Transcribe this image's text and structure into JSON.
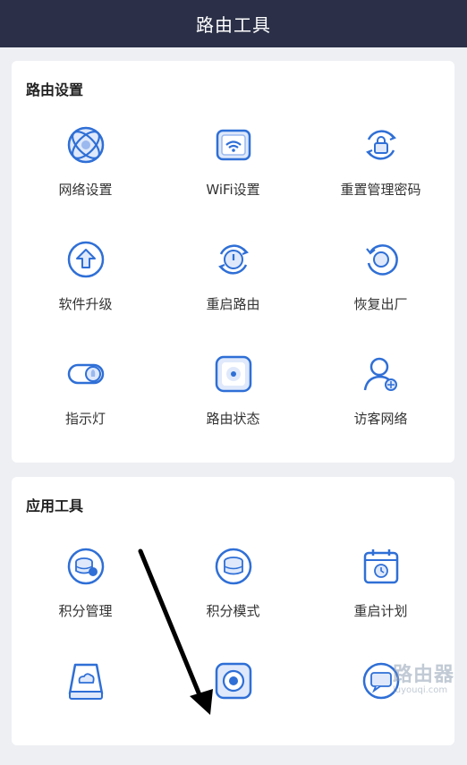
{
  "header": {
    "title": "路由工具"
  },
  "router_settings": {
    "title": "路由设置",
    "items": [
      {
        "label": "网络设置",
        "icon": "globe-icon"
      },
      {
        "label": "WiFi设置",
        "icon": "wifi-icon"
      },
      {
        "label": "重置管理密码",
        "icon": "lock-reset-icon"
      },
      {
        "label": "软件升级",
        "icon": "upgrade-arrow-icon"
      },
      {
        "label": "重启路由",
        "icon": "power-restart-icon"
      },
      {
        "label": "恢复出厂",
        "icon": "factory-reset-icon"
      },
      {
        "label": "指示灯",
        "icon": "indicator-toggle-icon"
      },
      {
        "label": "路由状态",
        "icon": "router-status-icon"
      },
      {
        "label": "访客网络",
        "icon": "guest-user-icon"
      }
    ]
  },
  "app_tools": {
    "title": "应用工具",
    "items": [
      {
        "label": "积分管理",
        "icon": "points-manage-icon"
      },
      {
        "label": "积分模式",
        "icon": "points-mode-icon"
      },
      {
        "label": "重启计划",
        "icon": "restart-schedule-icon"
      },
      {
        "label": "",
        "icon": "cloud-storage-icon"
      },
      {
        "label": "",
        "icon": "target-device-icon"
      },
      {
        "label": "",
        "icon": "message-icon"
      }
    ]
  },
  "watermark": {
    "main": "路由器",
    "sub": "luyouqi.com"
  },
  "colors": {
    "header_bg": "#2b3048",
    "icon_blue": "#2f6fd6",
    "icon_fill": "#dfe9fb"
  }
}
